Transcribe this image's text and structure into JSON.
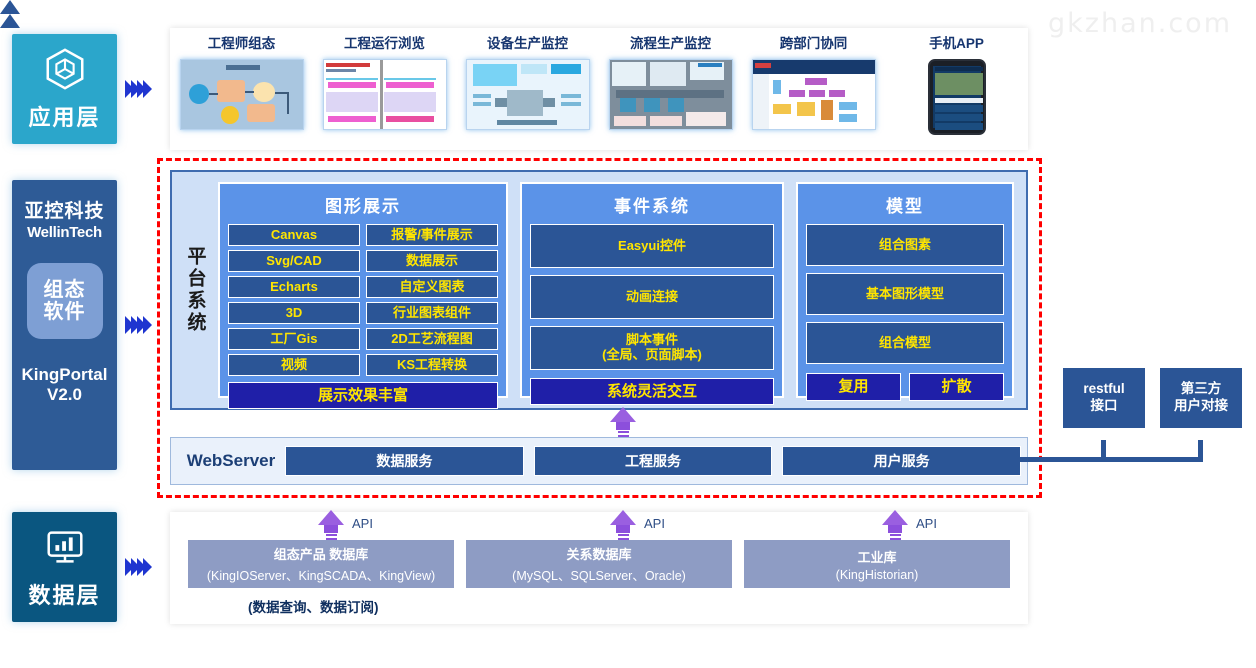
{
  "watermark": "gkzhan.com",
  "rail": {
    "application": {
      "label": "应用层",
      "icon": "cube-box-icon"
    },
    "middle": {
      "brand_cn": "亚控科技",
      "brand_en": "WellinTech",
      "chip_line1": "组态",
      "chip_line2": "软件",
      "product_line1": "KingPortal",
      "product_line2": "V2.0"
    },
    "data": {
      "label": "数据层",
      "icon": "monitor-chart-icon"
    }
  },
  "applications": [
    {
      "title": "工程师组态",
      "thumb": "engineer-configuration-thumb"
    },
    {
      "title": "工程运行浏览",
      "thumb": "project-runtime-browse-thumb"
    },
    {
      "title": "设备生产监控",
      "thumb": "equipment-monitoring-thumb"
    },
    {
      "title": "流程生产监控",
      "thumb": "process-monitoring-thumb"
    },
    {
      "title": "跨部门协同",
      "thumb": "cross-department-thumb"
    },
    {
      "title": "手机APP",
      "thumb": "mobile-app-thumb"
    }
  ],
  "platform": {
    "vertical_label": "平台系统",
    "graphics": {
      "title": "图形展示",
      "items": [
        "Canvas",
        "报警/事件展示",
        "Svg/CAD",
        "数据展示",
        "Echarts",
        "自定义图表",
        "3D",
        "行业图表组件",
        "工厂Gis",
        "2D工艺流程图",
        "视频",
        "KS工程转换"
      ],
      "summary": "展示效果丰富"
    },
    "events": {
      "title": "事件系统",
      "items": [
        "Easyui控件",
        "动画连接",
        "脚本事件\n(全局、页面脚本)"
      ],
      "summary": "系统灵活交互"
    },
    "model": {
      "title": "模型",
      "items": [
        "组合图素",
        "基本图形模型",
        "组合模型"
      ],
      "pair": [
        "复用",
        "扩散"
      ]
    }
  },
  "webserver": {
    "label": "WebServer",
    "services": [
      "数据服务",
      "工程服务",
      "用户服务"
    ]
  },
  "connectors": {
    "restful": "restful\n接口",
    "restful_l1": "restful",
    "restful_l2": "接口",
    "third_party_l1": "第三方",
    "third_party_l2": "用户对接"
  },
  "data_layer": {
    "api_label": "API",
    "databases": [
      {
        "name": "组态产品 数据库",
        "detail": "(KingIOServer、KingSCADA、KingView)"
      },
      {
        "name": "关系数据库",
        "detail": "(MySQL、SQLServer、Oracle)"
      },
      {
        "name": "工业库",
        "detail": "(KingHistorian)"
      }
    ],
    "note": "(数据查询、数据订阅)"
  },
  "colors": {
    "app_layer": "#2ba6cb",
    "mid_layer": "#2e5b96",
    "data_layer": "#0a5680",
    "chip_blue": "#2b5596",
    "chip_dark": "#1f1fa8",
    "chip_text": "#ffe500",
    "panel_blue": "#5b93e8",
    "platform_bg": "#cfe0f7",
    "red_border": "#ff0000",
    "purple_arrow": "#8c4fdc",
    "db_box": "#8e9cc4"
  }
}
